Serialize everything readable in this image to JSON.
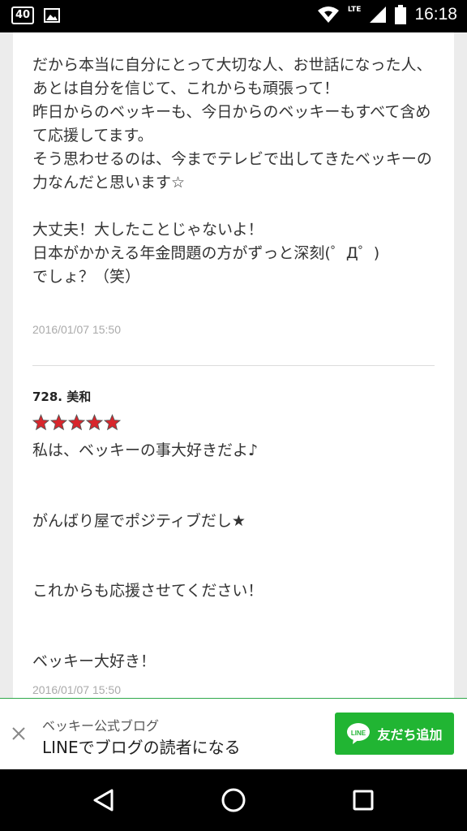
{
  "status_bar": {
    "badge": "40",
    "network": "LTE",
    "time": "16:18",
    "icons": [
      "notification-count-icon",
      "image-icon",
      "wifi-icon",
      "signal-icon",
      "battery-icon"
    ]
  },
  "post": {
    "body": "だから本当に自分にとって大切な人、お世話になった人、\nあとは自分を信じて、これからも頑張って！\n昨日からのベッキーも、今日からのベッキーもすべて含めて応援してます。\nそう思わせるのは、今までテレビで出してきたベッキーの力なんだと思います☆\n\n大丈夫！大したことじゃないよ！\n日本がかかえる年金問題の方がずっと深刻(゜Д゜)\nでしょ？（笑）",
    "timestamp": "2016/01/07 15:50"
  },
  "comment": {
    "number": "728.",
    "author": "美和",
    "star_count": 5,
    "star_color": "#d8262c",
    "lines": [
      "私は、ベッキーの事大好きだよ♪",
      "がんばり屋でポジティブだし★",
      "これからも応援させてください！",
      "ベッキー大好き！"
    ],
    "timestamp": "2016/01/07 15:50"
  },
  "banner": {
    "subtitle": "ベッキー公式ブログ",
    "title": "LINEでブログの読者になる",
    "button_label": "友だち追加",
    "button_color": "#21b533",
    "close_icon": "close-icon",
    "line_icon": "line-logo-icon"
  },
  "nav_bar": {
    "icons": [
      "back-icon",
      "home-icon",
      "recents-icon"
    ]
  }
}
